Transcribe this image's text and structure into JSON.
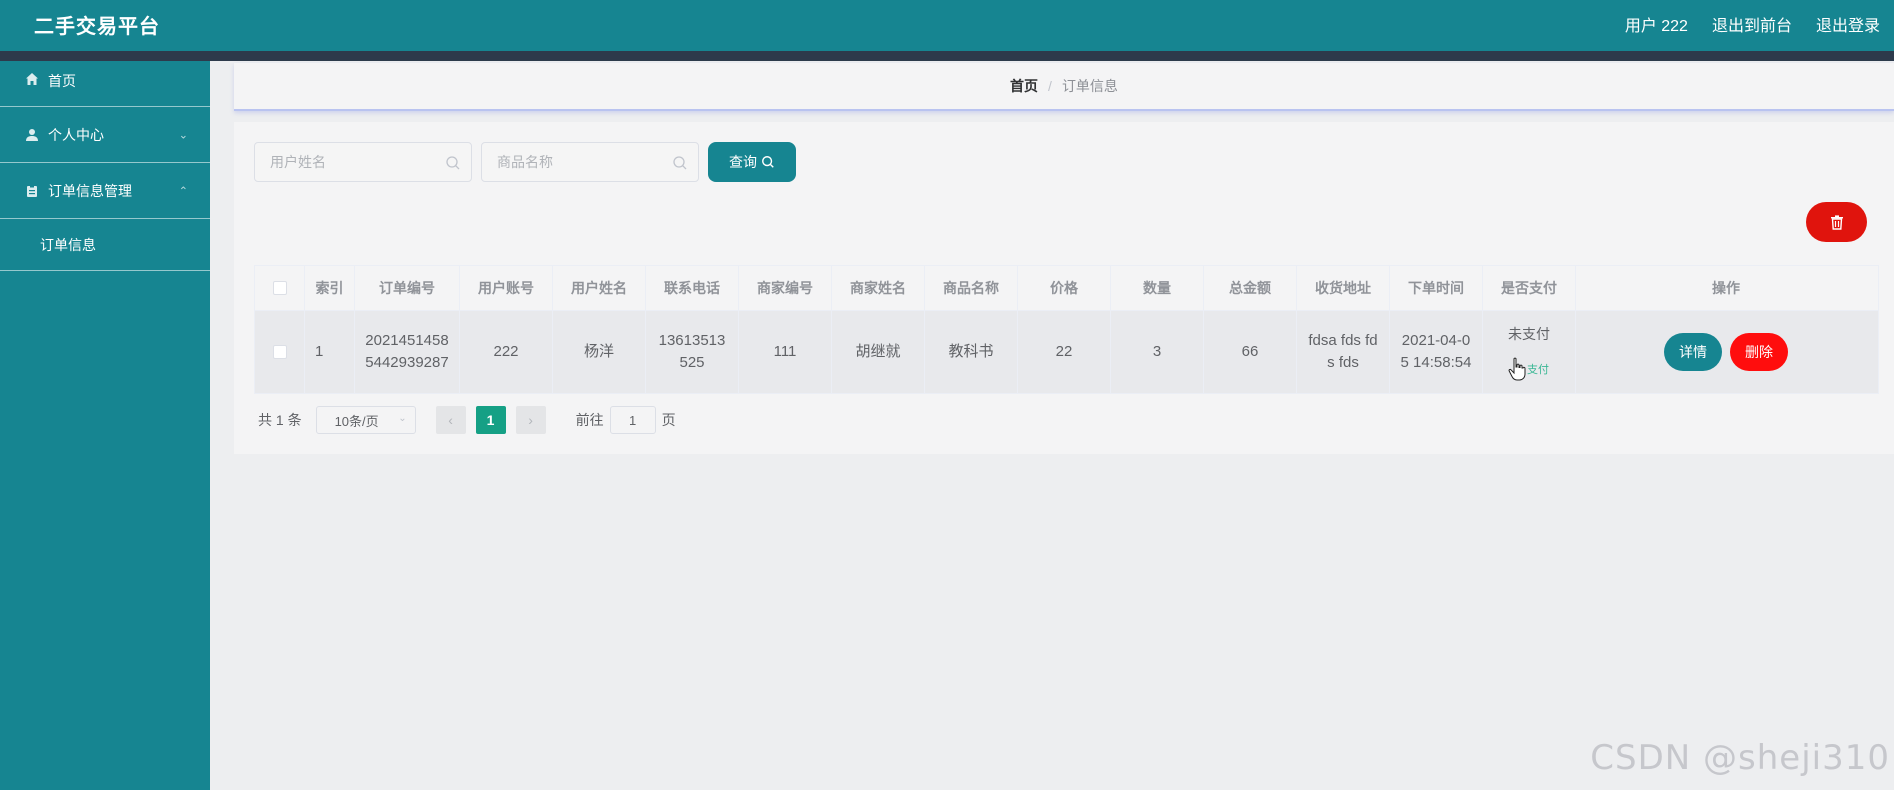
{
  "header": {
    "brand": "二手交易平台",
    "user": "用户 222",
    "front": "退出到前台",
    "logout": "退出登录"
  },
  "sidebar": {
    "items": [
      {
        "label": "首页",
        "icon": "home-icon"
      },
      {
        "label": "个人中心",
        "icon": "user-icon"
      },
      {
        "label": "订单信息管理",
        "icon": "clipboard-icon"
      }
    ],
    "sub": "订单信息"
  },
  "breadcrumb": {
    "home": "首页",
    "sep": "/",
    "current": "订单信息"
  },
  "search": {
    "user_placeholder": "用户姓名",
    "product_placeholder": "商品名称",
    "button": "查询"
  },
  "table": {
    "headers": [
      "索引",
      "订单编号",
      "用户账号",
      "用户姓名",
      "联系电话",
      "商家编号",
      "商家姓名",
      "商品名称",
      "价格",
      "数量",
      "总金额",
      "收货地址",
      "下单时间",
      "是否支付",
      "操作"
    ],
    "row": {
      "index": "1",
      "order_no_1": "2021451458",
      "order_no_2": "5442939287",
      "account": "222",
      "name": "杨洋",
      "phone_1": "13613513",
      "phone_2": "525",
      "merchant_no": "111",
      "merchant_name": "胡继就",
      "product": "教科书",
      "price": "22",
      "qty": "3",
      "total": "66",
      "addr_1": "fdsa fds fd",
      "addr_2": "s fds",
      "time_1": "2021-04-0",
      "time_2": "5 14:58:54",
      "paid_status": "未支付",
      "pay_link": "支付",
      "detail": "详情",
      "delete": "删除"
    }
  },
  "pager": {
    "total": "共 1 条",
    "size": "10条/页",
    "page": "1",
    "goto_prefix": "前往",
    "goto_value": "1",
    "goto_suffix": "页"
  },
  "watermark": "CSDN @sheji310",
  "colors": {
    "primary": "#168591",
    "danger": "#ff0d0d",
    "pager_active": "#15a085"
  }
}
